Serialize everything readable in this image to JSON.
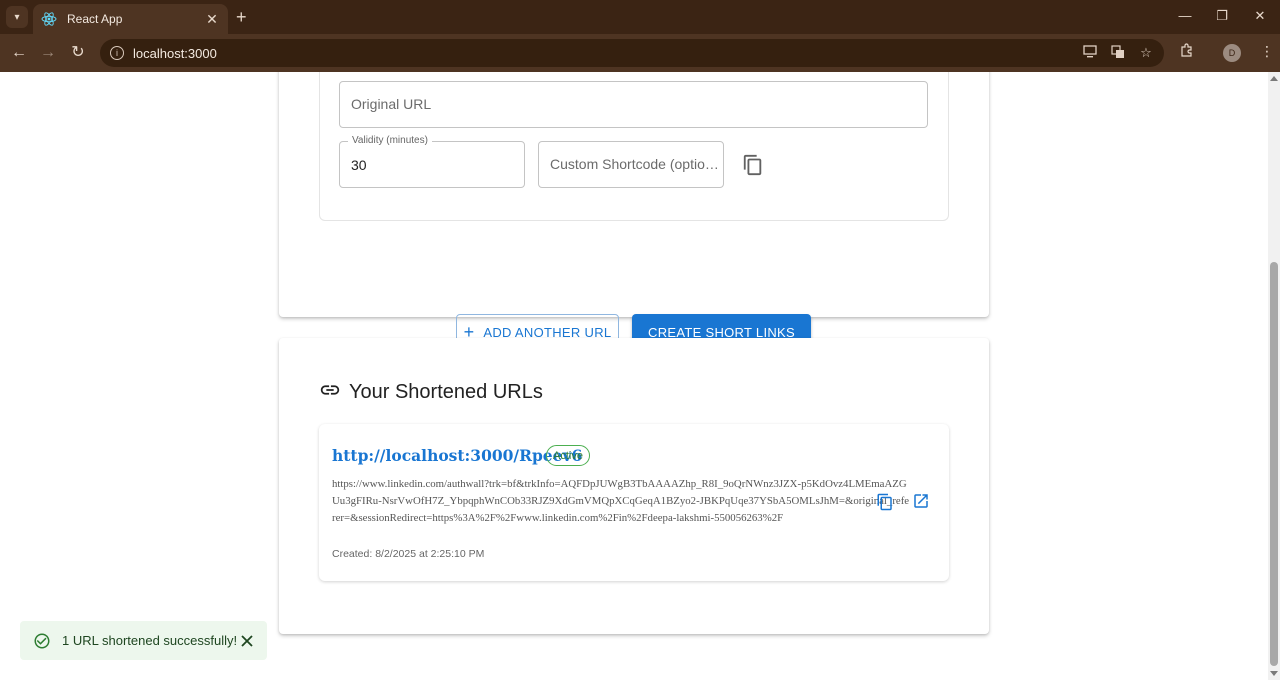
{
  "browser": {
    "tab_title": "React App",
    "tab_close": "✕",
    "new_tab": "+",
    "address": "localhost:3000",
    "profile_initial": "D",
    "window_minimize": "—",
    "window_restore": "❐",
    "window_close": "✕",
    "nav_back": "←",
    "nav_forward": "→",
    "nav_reload": "↻"
  },
  "form": {
    "original_url_placeholder": "Original URL",
    "validity_label": "Validity (minutes)",
    "validity_value": "30",
    "shortcode_placeholder": "Custom Shortcode (optio…",
    "add_another_url_label": "ADD ANOTHER URL",
    "add_icon": "+",
    "create_short_links_label": "CREATE SHORT LINKS"
  },
  "results": {
    "section_title": "Your Shortened URLs",
    "items": [
      {
        "short_url": "http://localhost:3000/Rpeev6",
        "status": "Active",
        "original_url": "https://www.linkedin.com/authwall?trk=bf&trkInfo=AQFDpJUWgB3TbAAAAZhp_R8I_9oQrNWnz3JZX-p5KdOvz4LMEmaAZGUu3gFIRu-NsrVwOfH7Z_YbpqphWnCOb33RJZ9XdGmVMQpXCqGeqA1BZyo2-JBKPqUqe37YSbA5OMLsJhM=&original_referer=&sessionRedirect=https%3A%2F%2Fwww.linkedin.com%2Fin%2Fdeepa-lakshmi-550056263%2F",
        "created": "Created: 8/2/2025 at 2:25:10 PM"
      }
    ]
  },
  "snackbar": {
    "message": "1 URL shortened successfully!"
  },
  "colors": {
    "primary": "#1976d2",
    "success": "#2e7d32",
    "chrome_dark": "#3b2414",
    "chrome_toolbar": "#4e3422"
  }
}
